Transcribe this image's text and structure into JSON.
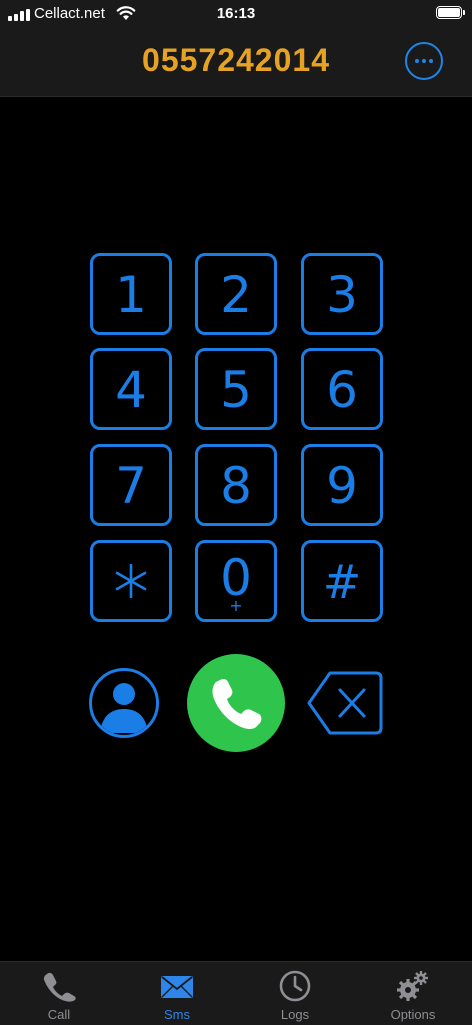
{
  "status_bar": {
    "carrier": "Cellact.net",
    "time": "16:13"
  },
  "header": {
    "phone_number": "0557242014",
    "accent_color": "#e6a323"
  },
  "keypad": {
    "accent_color": "#1b7ee6",
    "keys": [
      {
        "digit": "1"
      },
      {
        "digit": "2"
      },
      {
        "digit": "3"
      },
      {
        "digit": "4"
      },
      {
        "digit": "5"
      },
      {
        "digit": "6"
      },
      {
        "digit": "7"
      },
      {
        "digit": "8"
      },
      {
        "digit": "9"
      },
      {
        "digit": "*",
        "icon": "asterisk-icon"
      },
      {
        "digit": "0",
        "sub": "+"
      },
      {
        "digit": "#"
      }
    ]
  },
  "actions": {
    "contacts_icon": "person-icon",
    "call_icon": "phone-handset-icon",
    "call_color": "#2fc54d",
    "backspace_icon": "backspace-icon"
  },
  "tab_bar": {
    "active_color": "#2d86e8",
    "tabs": [
      {
        "label": "Call",
        "icon": "phone-icon"
      },
      {
        "label": "Sms",
        "icon": "envelope-icon",
        "active": true
      },
      {
        "label": "Logs",
        "icon": "clock-icon"
      },
      {
        "label": "Options",
        "icon": "gears-icon"
      }
    ]
  }
}
